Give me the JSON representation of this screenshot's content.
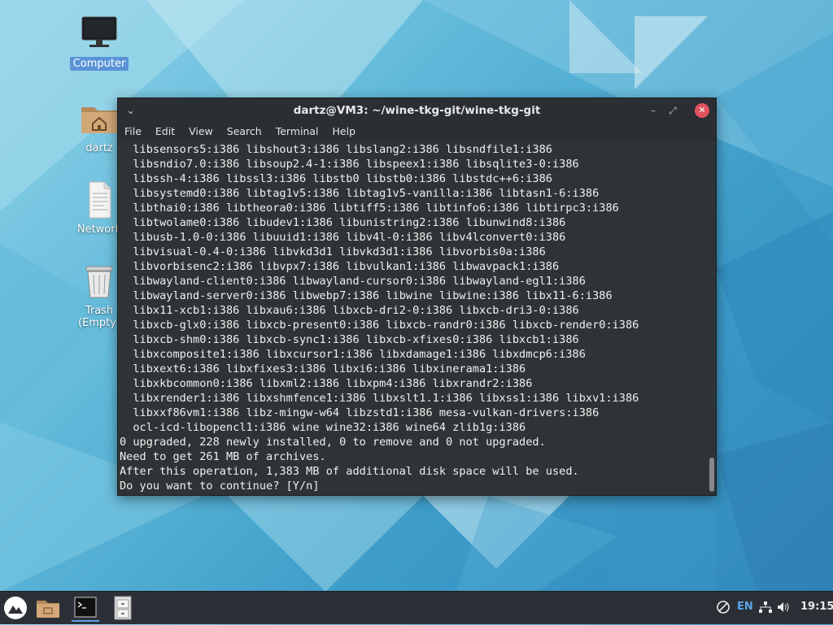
{
  "desktop": {
    "icons": [
      {
        "label": "Computer",
        "icon": "computer-icon",
        "selected": true
      },
      {
        "label": "dartz",
        "icon": "home-folder-icon",
        "selected": false
      },
      {
        "label": "Network",
        "icon": "network-icon",
        "selected": false
      },
      {
        "label": "Trash (Empty)",
        "icon": "trash-icon",
        "selected": false
      }
    ]
  },
  "terminal": {
    "title": "dartz@VM3: ~/wine-tkg-git/wine-tkg-git",
    "menu": [
      "File",
      "Edit",
      "View",
      "Search",
      "Terminal",
      "Help"
    ],
    "lines": [
      "  libsensors5:i386 libshout3:i386 libslang2:i386 libsndfile1:i386",
      "  libsndio7.0:i386 libsoup2.4-1:i386 libspeex1:i386 libsqlite3-0:i386",
      "  libssh-4:i386 libssl3:i386 libstb0 libstb0:i386 libstdc++6:i386",
      "  libsystemd0:i386 libtag1v5:i386 libtag1v5-vanilla:i386 libtasn1-6:i386",
      "  libthai0:i386 libtheora0:i386 libtiff5:i386 libtinfo6:i386 libtirpc3:i386",
      "  libtwolame0:i386 libudev1:i386 libunistring2:i386 libunwind8:i386",
      "  libusb-1.0-0:i386 libuuid1:i386 libv4l-0:i386 libv4lconvert0:i386",
      "  libvisual-0.4-0:i386 libvkd3d1 libvkd3d1:i386 libvorbis0a:i386",
      "  libvorbisenc2:i386 libvpx7:i386 libvulkan1:i386 libwavpack1:i386",
      "  libwayland-client0:i386 libwayland-cursor0:i386 libwayland-egl1:i386",
      "  libwayland-server0:i386 libwebp7:i386 libwine libwine:i386 libx11-6:i386",
      "  libx11-xcb1:i386 libxau6:i386 libxcb-dri2-0:i386 libxcb-dri3-0:i386",
      "  libxcb-glx0:i386 libxcb-present0:i386 libxcb-randr0:i386 libxcb-render0:i386",
      "  libxcb-shm0:i386 libxcb-sync1:i386 libxcb-xfixes0:i386 libxcb1:i386",
      "  libxcomposite1:i386 libxcursor1:i386 libxdamage1:i386 libxdmcp6:i386",
      "  libxext6:i386 libxfixes3:i386 libxi6:i386 libxinerama1:i386",
      "  libxkbcommon0:i386 libxml2:i386 libxpm4:i386 libxrandr2:i386",
      "  libxrender1:i386 libxshmfence1:i386 libxslt1.1:i386 libxss1:i386 libxv1:i386",
      "  libxxf86vm1:i386 libz-mingw-w64 libzstd1:i386 mesa-vulkan-drivers:i386",
      "  ocl-icd-libopencl1:i386 wine wine32:i386 wine64 zlib1g:i386",
      "0 upgraded, 228 newly installed, 0 to remove and 0 not upgraded.",
      "Need to get 261 MB of archives.",
      "After this operation, 1,383 MB of additional disk space will be used.",
      "Do you want to continue? [Y/n] "
    ]
  },
  "taskbar": {
    "launcher_icon": "distro-logo-icon",
    "apps": [
      {
        "name": "file-manager-icon",
        "active": false
      },
      {
        "name": "terminal-icon",
        "active": true
      },
      {
        "name": "file-cabinet-icon",
        "active": false
      }
    ],
    "tray": {
      "keyboard_layout": "EN",
      "clock": "19:15"
    }
  },
  "colors": {
    "terminal_bg": "#2e3436",
    "titlebar_bg": "#2b2e33",
    "close_button": "#e0535d",
    "selection": "#5a94d6",
    "taskbar_bg": "#2c3036"
  }
}
